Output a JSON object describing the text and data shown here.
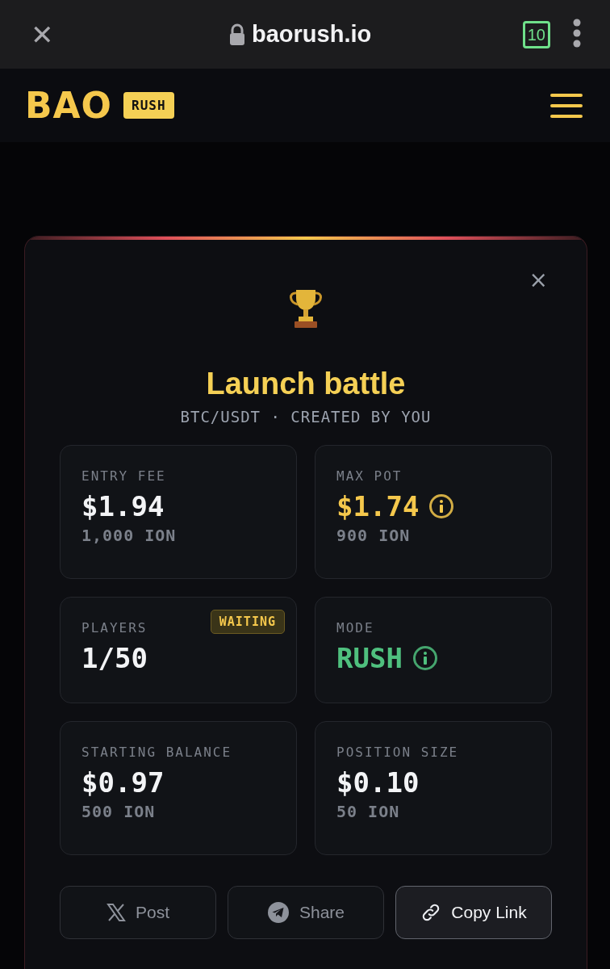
{
  "browser": {
    "close": "✕",
    "url": "baorush.io",
    "tab_count": "10"
  },
  "header": {
    "logo": "BAO",
    "logo_badge": "RUSH"
  },
  "modal": {
    "close": "×",
    "title": "Launch battle",
    "subtitle": "BTC/USDT · CREATED BY YOU",
    "stats": [
      {
        "label": "ENTRY FEE",
        "value": "$1.94",
        "sub": "1,000 ION",
        "color": "#f3f4f6",
        "info": false
      },
      {
        "label": "MAX POT",
        "value": "$1.74",
        "sub": "900 ION",
        "color": "#f5c84c",
        "info": true
      },
      {
        "label": "PLAYERS",
        "value": "1/50",
        "badge": "WAITING",
        "color": "#f3f4f6",
        "info": false
      },
      {
        "label": "MODE",
        "value": "RUSH",
        "color": "#4fc07e",
        "info": true
      },
      {
        "label": "STARTING BALANCE",
        "value": "$0.97",
        "sub": "500 ION",
        "color": "#f3f4f6",
        "info": false
      },
      {
        "label": "POSITION SIZE",
        "value": "$0.10",
        "sub": "50 ION",
        "color": "#f3f4f6",
        "info": false
      }
    ],
    "actions": [
      {
        "label": "Post",
        "kind": "x",
        "highlighted": false
      },
      {
        "label": "Share",
        "kind": "telegram",
        "highlighted": false
      },
      {
        "label": "Copy Link",
        "kind": "link",
        "highlighted": true
      }
    ]
  }
}
